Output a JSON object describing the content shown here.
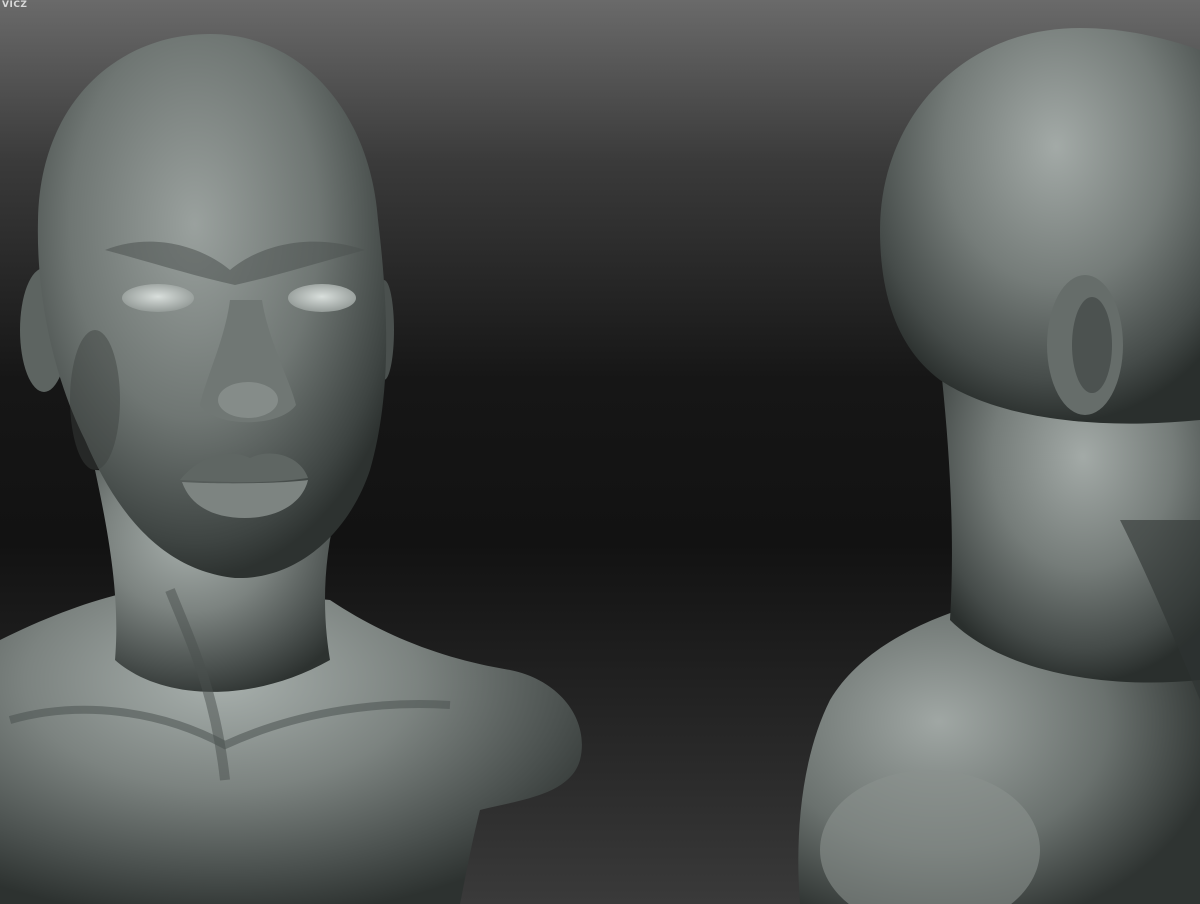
{
  "watermark": {
    "text": "VICZ"
  },
  "views": [
    {
      "id": "front",
      "description_icon": "front-bust-view"
    },
    {
      "id": "back",
      "description_icon": "back-three-quarter-view"
    }
  ],
  "colors": {
    "background_top": "#6a6a6a",
    "background_mid": "#141414",
    "background_bottom": "#3a3a3a",
    "clay_highlight": "#a8b0ad",
    "clay_mid": "#6f7673",
    "clay_shadow": "#2d3230"
  }
}
